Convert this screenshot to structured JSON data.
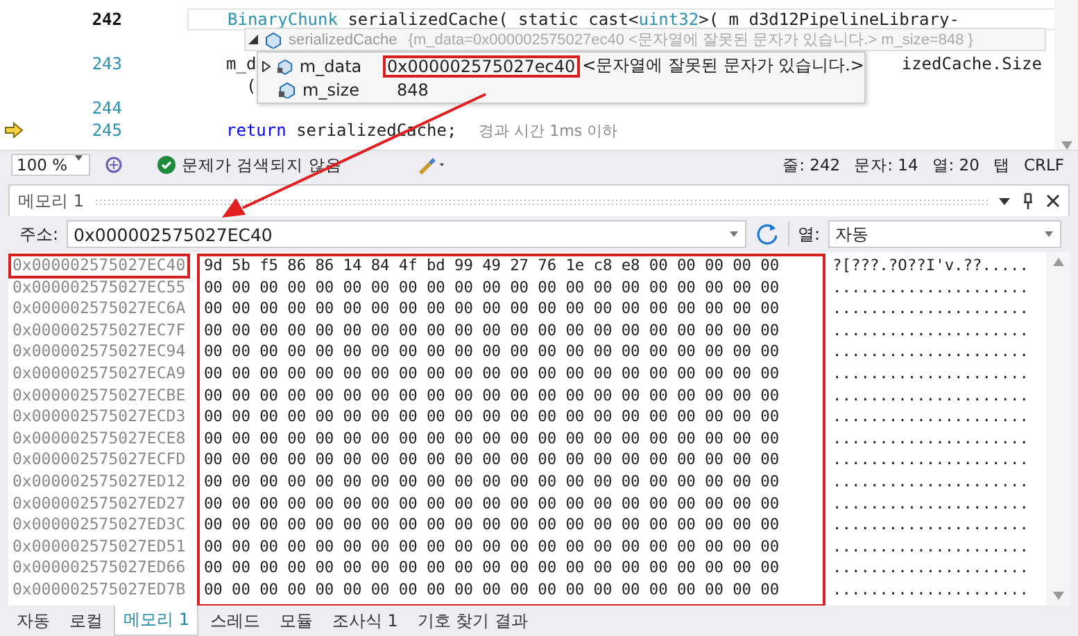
{
  "editor": {
    "rows": [
      {
        "number": "242",
        "current": true,
        "execution": false,
        "tokens": [
          {
            "kind": "type",
            "text": "BinaryChunk"
          },
          {
            "kind": "plain",
            "text": " serializedCache( static cast<"
          },
          {
            "kind": "type",
            "text": "uint32"
          },
          {
            "kind": "plain",
            "text": ">( m d3d12PipelineLibrary-"
          }
        ]
      },
      {
        "current": false,
        "execution": false
      },
      {
        "number": "243",
        "current": false,
        "execution": false,
        "tokens": [
          {
            "kind": "plain",
            "text": "m_d"
          },
          {
            "kind": "tail",
            "text": "izedCache.Size"
          }
        ]
      },
      {
        "current": false,
        "execution": false,
        "tokens": [
          {
            "kind": "plain",
            "text": "  ("
          }
        ]
      },
      {
        "number": "244",
        "current": false,
        "execution": false
      },
      {
        "number": "245",
        "current": false,
        "execution": true,
        "tokens": [
          {
            "kind": "keyword",
            "text": "return"
          },
          {
            "kind": "plain",
            "text": " serializedCache;"
          },
          {
            "kind": "hint",
            "text": "경과 시간 1ms 이하"
          }
        ]
      }
    ],
    "tooltip": {
      "name": "serializedCache",
      "summary": "{m_data=0x000002575027ec40 <문자열에 잘못된 문자가 있습니다.> m_size=848 }",
      "expanded": true,
      "members": [
        {
          "name": "m_data",
          "value": "0x000002575027ec40",
          "note": "<문자열에 잘못된 문자가 있습니다.>",
          "expandable": true,
          "annotated": true
        },
        {
          "name": "m_size",
          "value": "848",
          "expandable": false,
          "annotated": false
        }
      ]
    }
  },
  "status_bar": {
    "zoom": "100 %",
    "issues": "문제가 검색되지 않음",
    "line": "줄: 242",
    "char": "문자: 14",
    "col": "열: 20",
    "tab": "탭",
    "eol": "CRLF"
  },
  "memory": {
    "title": "메모리 1",
    "address_label": "주소:",
    "address": "0x000002575027EC40",
    "columns_label": "열:",
    "columns_value": "자동",
    "bytes_annotated": true,
    "rows": [
      {
        "address": "0x000002575027EC40",
        "bytes": "9d 5b f5 86 86 14 84 4f bd 99 49 27 76 1e c8 e8 00 00 00 00 00",
        "ascii": "?[???.?O??I'v.??.....",
        "annotated": true
      },
      {
        "address": "0x000002575027EC55",
        "bytes": "00 00 00 00 00 00 00 00 00 00 00 00 00 00 00 00 00 00 00 00 00",
        "ascii": ".....................",
        "annotated": false
      },
      {
        "address": "0x000002575027EC6A",
        "bytes": "00 00 00 00 00 00 00 00 00 00 00 00 00 00 00 00 00 00 00 00 00",
        "ascii": ".....................",
        "annotated": false
      },
      {
        "address": "0x000002575027EC7F",
        "bytes": "00 00 00 00 00 00 00 00 00 00 00 00 00 00 00 00 00 00 00 00 00",
        "ascii": ".....................",
        "annotated": false
      },
      {
        "address": "0x000002575027EC94",
        "bytes": "00 00 00 00 00 00 00 00 00 00 00 00 00 00 00 00 00 00 00 00 00",
        "ascii": ".....................",
        "annotated": false
      },
      {
        "address": "0x000002575027ECA9",
        "bytes": "00 00 00 00 00 00 00 00 00 00 00 00 00 00 00 00 00 00 00 00 00",
        "ascii": ".....................",
        "annotated": false
      },
      {
        "address": "0x000002575027ECBE",
        "bytes": "00 00 00 00 00 00 00 00 00 00 00 00 00 00 00 00 00 00 00 00 00",
        "ascii": ".....................",
        "annotated": false
      },
      {
        "address": "0x000002575027ECD3",
        "bytes": "00 00 00 00 00 00 00 00 00 00 00 00 00 00 00 00 00 00 00 00 00",
        "ascii": ".....................",
        "annotated": false
      },
      {
        "address": "0x000002575027ECE8",
        "bytes": "00 00 00 00 00 00 00 00 00 00 00 00 00 00 00 00 00 00 00 00 00",
        "ascii": ".....................",
        "annotated": false
      },
      {
        "address": "0x000002575027ECFD",
        "bytes": "00 00 00 00 00 00 00 00 00 00 00 00 00 00 00 00 00 00 00 00 00",
        "ascii": ".....................",
        "annotated": false
      },
      {
        "address": "0x000002575027ED12",
        "bytes": "00 00 00 00 00 00 00 00 00 00 00 00 00 00 00 00 00 00 00 00 00",
        "ascii": ".....................",
        "annotated": false
      },
      {
        "address": "0x000002575027ED27",
        "bytes": "00 00 00 00 00 00 00 00 00 00 00 00 00 00 00 00 00 00 00 00 00",
        "ascii": ".....................",
        "annotated": false
      },
      {
        "address": "0x000002575027ED3C",
        "bytes": "00 00 00 00 00 00 00 00 00 00 00 00 00 00 00 00 00 00 00 00 00",
        "ascii": ".....................",
        "annotated": false
      },
      {
        "address": "0x000002575027ED51",
        "bytes": "00 00 00 00 00 00 00 00 00 00 00 00 00 00 00 00 00 00 00 00 00",
        "ascii": ".....................",
        "annotated": false
      },
      {
        "address": "0x000002575027ED66",
        "bytes": "00 00 00 00 00 00 00 00 00 00 00 00 00 00 00 00 00 00 00 00 00",
        "ascii": ".....................",
        "annotated": false
      },
      {
        "address": "0x000002575027ED7B",
        "bytes": "00 00 00 00 00 00 00 00 00 00 00 00 00 00 00 00 00 00 00 00 00",
        "ascii": ".....................",
        "annotated": false
      }
    ]
  },
  "tabs": [
    {
      "label": "자동",
      "selected": false
    },
    {
      "label": "로컬",
      "selected": false
    },
    {
      "label": "메모리 1",
      "selected": true
    },
    {
      "label": "스레드",
      "selected": false
    },
    {
      "label": "모듈",
      "selected": false
    },
    {
      "label": "조사식 1",
      "selected": false
    },
    {
      "label": "기호 찾기 결과",
      "selected": false
    }
  ]
}
